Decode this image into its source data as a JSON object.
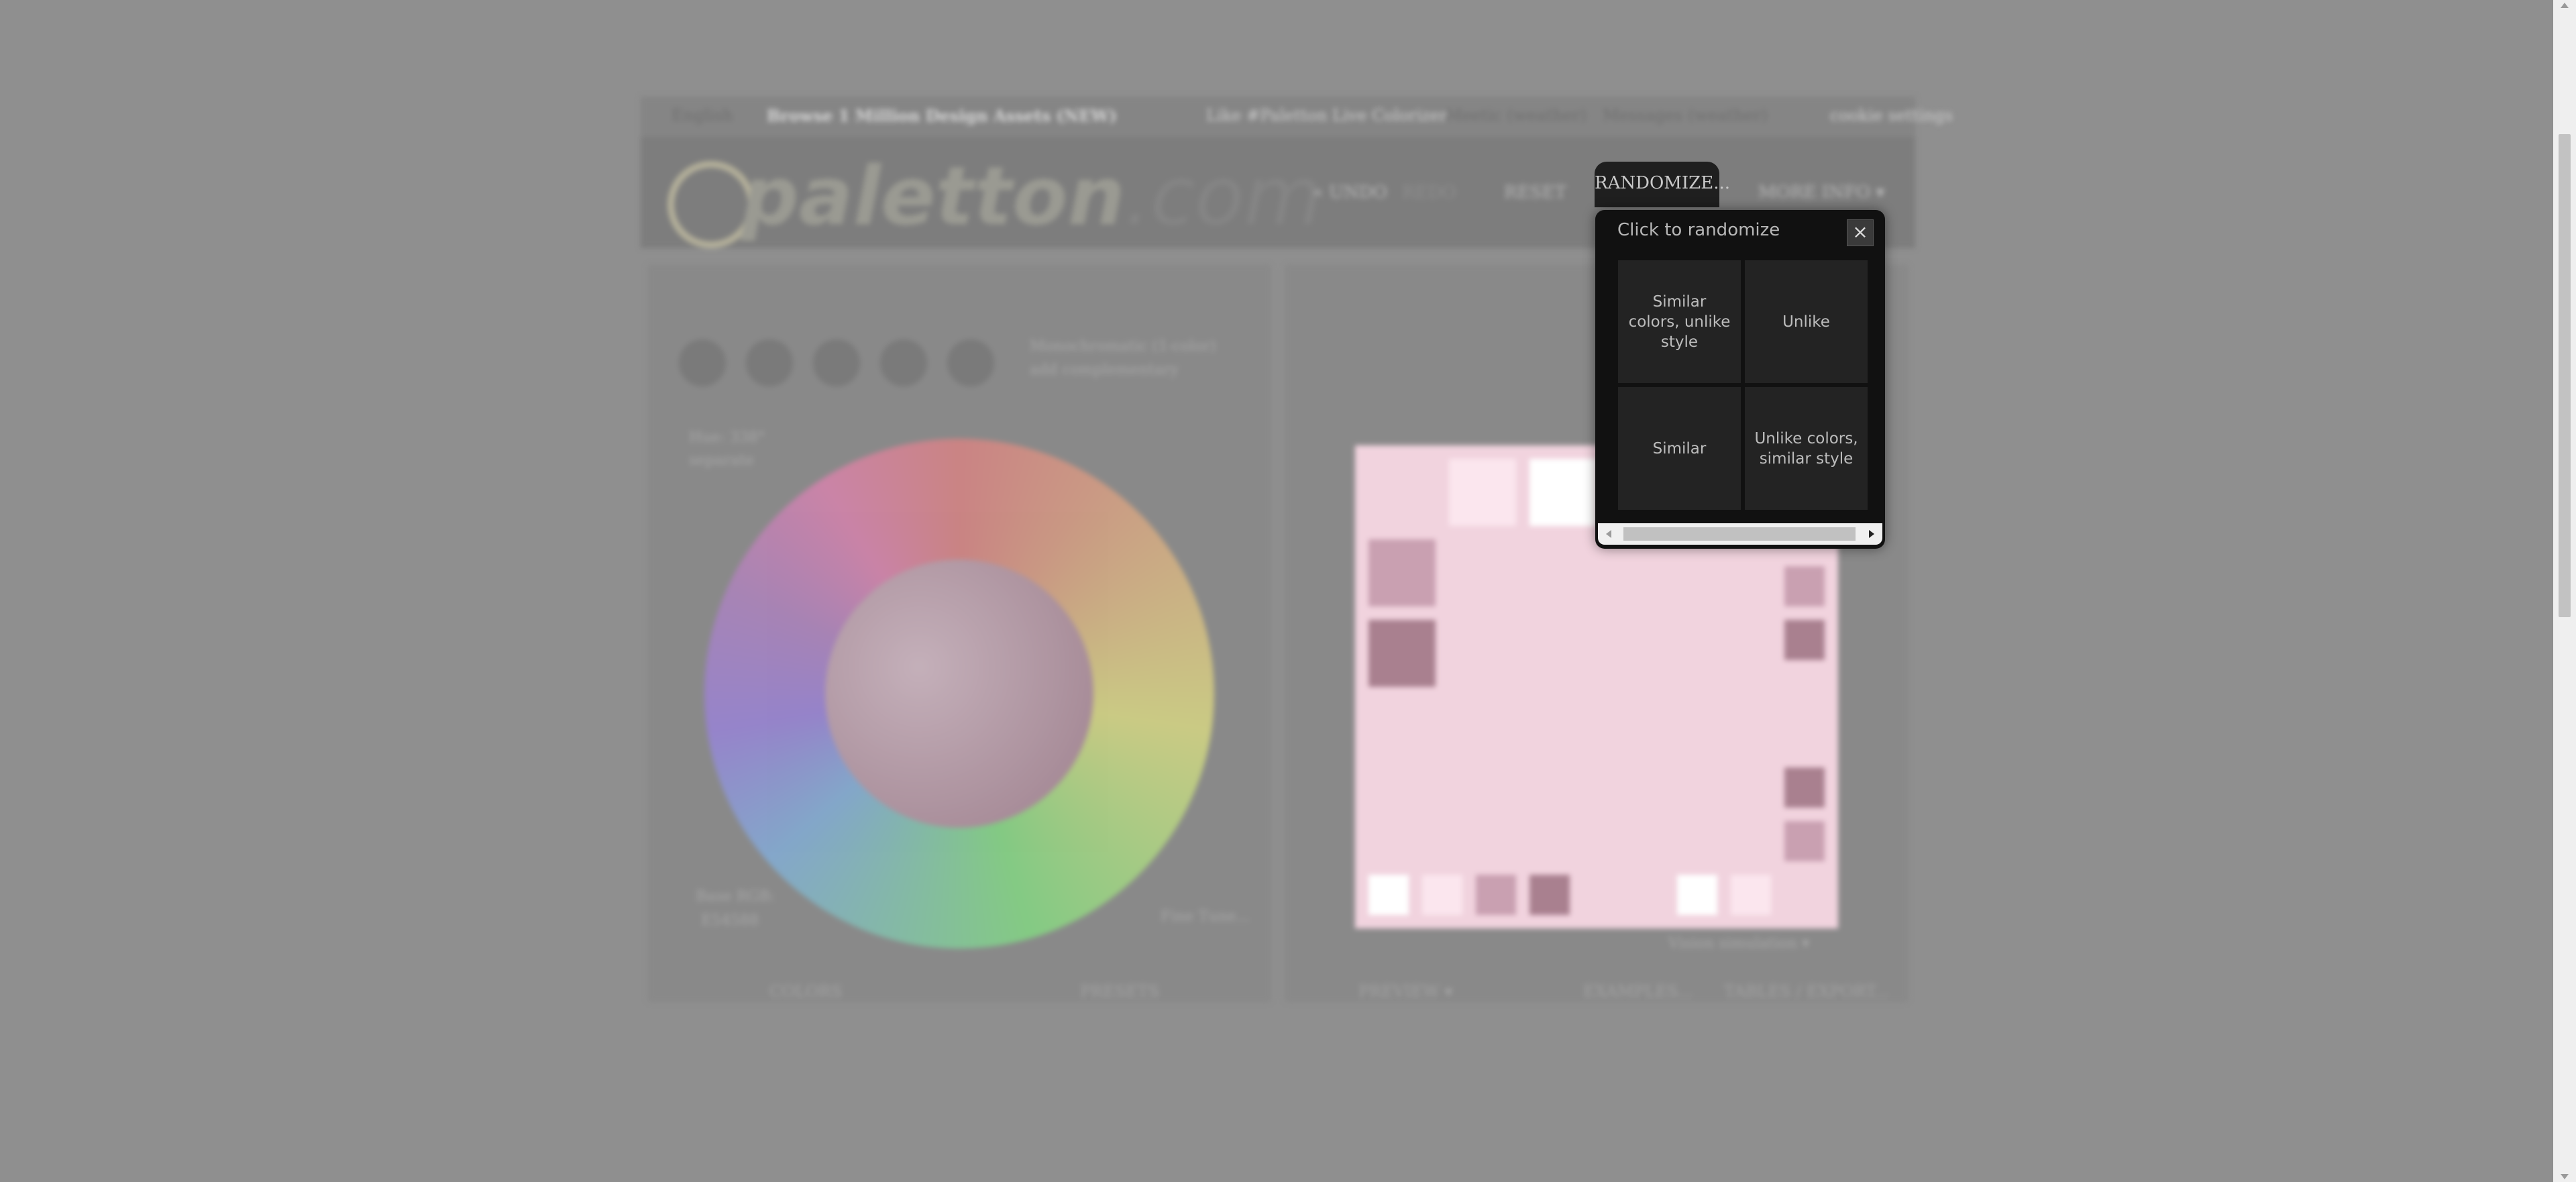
{
  "background_app": {
    "topbar": {
      "language": "English",
      "browse": "Browse 1 Million Design Assets (NEW)",
      "like": "Like #Paletton Live Colorizer",
      "status1": "Meetic (weather)",
      "status2": "Messages (weather)",
      "cookie": "cookie settings"
    },
    "logo": {
      "main": "paletton",
      "suffix": ".com"
    },
    "menu": {
      "undo": "« UNDO",
      "redo": "REDO",
      "reset": "RESET",
      "more": "MORE INFO ▾"
    },
    "mode_label": "Monochromatic (1-color)",
    "mode_sub": "add complementary",
    "hue_label": "Hue: 338°",
    "hue_sub": "separate",
    "base_rgb_label": "Base RGB:",
    "base_rgb_value": "E54588",
    "fine_tune": "Fine Tune...",
    "vision": "Vision simulation ▾",
    "tabs": {
      "colors": "COLORS",
      "presets": "PRESETS",
      "preview": "PREVIEW ▾",
      "examples": "EXAMPLES...",
      "tables": "TABLES / EXPORT..."
    }
  },
  "randomize": {
    "tab_label": "RANDOMIZE...",
    "title": "Click to randomize",
    "close_symbol": "×",
    "options": [
      "Similar colors, unlike style",
      "Unlike",
      "Similar",
      "Unlike colors, similar style"
    ]
  },
  "colors": {
    "overlay": "#8f8f8f",
    "popup_bg": "#111111",
    "option_bg": "#232323",
    "preview_pink": "#f1d3de"
  }
}
